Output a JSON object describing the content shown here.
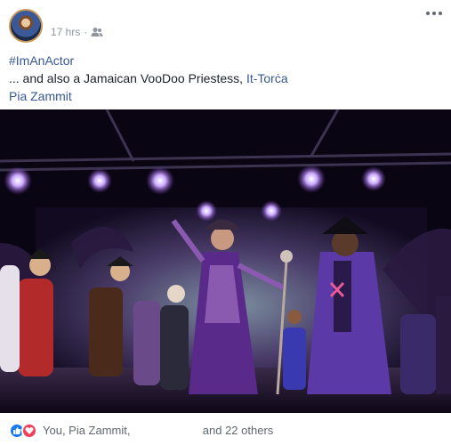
{
  "post": {
    "timestamp": "17 hrs",
    "separator": "·",
    "audience_icon": "friends-icon",
    "hashtag": "#ImAnActor",
    "text_before_link": "... and also a Jamaican VooDoo Priestess, ",
    "tag_it_torca": "It-Torċa",
    "tag_pia": "Pia Zammit"
  },
  "photo": {
    "description_icon": "stage-performance-photo"
  },
  "reactions": {
    "icons": [
      "like-icon",
      "love-icon"
    ],
    "names_prefix": "You, Pia Zammit,",
    "names_suffix": "and 22 others"
  },
  "colors": {
    "link": "#385898",
    "like": "#1877f2",
    "love": "#f33e58",
    "stage_purple": "#6a2fb0"
  }
}
